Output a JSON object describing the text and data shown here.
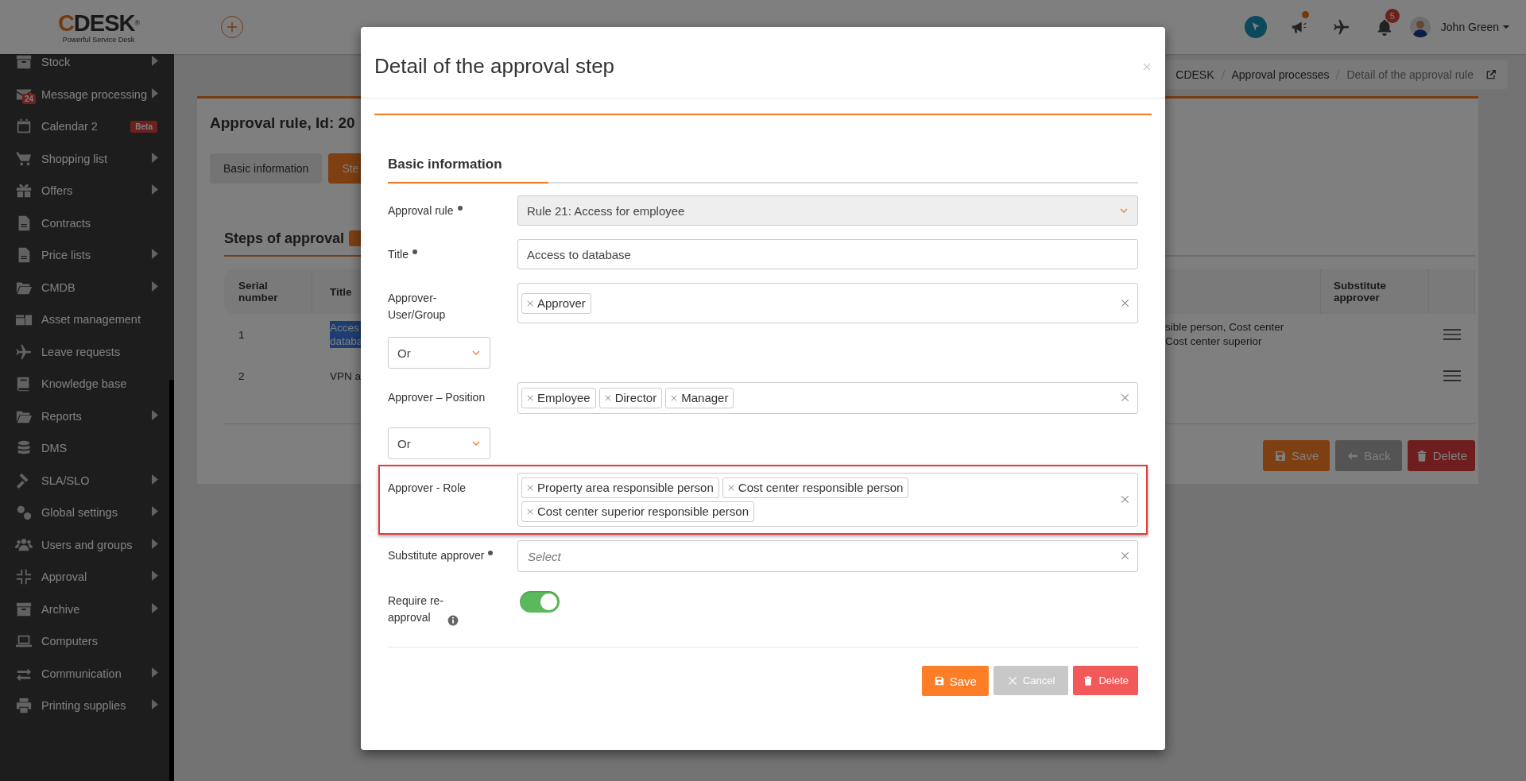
{
  "header": {
    "logo": "CDESK",
    "logo_mark": "®",
    "tagline": "Powerful Service Desk",
    "notifications": "5",
    "user": "John Green"
  },
  "sidebar": {
    "items": [
      {
        "label": "Stock",
        "submenu": true
      },
      {
        "label": "Message processing",
        "submenu": true,
        "badge": "24"
      },
      {
        "label": "Calendar 2",
        "submenu": false,
        "tag": "Beta"
      },
      {
        "label": "Shopping list",
        "submenu": true
      },
      {
        "label": "Offers",
        "submenu": true
      },
      {
        "label": "Contracts",
        "submenu": false
      },
      {
        "label": "Price lists",
        "submenu": true
      },
      {
        "label": "CMDB",
        "submenu": true
      },
      {
        "label": "Asset management",
        "submenu": false
      },
      {
        "label": "Leave requests",
        "submenu": false
      },
      {
        "label": "Knowledge base",
        "submenu": false
      },
      {
        "label": "Reports",
        "submenu": true
      },
      {
        "label": "DMS",
        "submenu": false
      },
      {
        "label": "SLA/SLO",
        "submenu": true
      },
      {
        "label": "Global settings",
        "submenu": true
      },
      {
        "label": "Users and groups",
        "submenu": true
      },
      {
        "label": "Approval",
        "submenu": true
      },
      {
        "label": "Archive",
        "submenu": true
      },
      {
        "label": "Computers",
        "submenu": false
      },
      {
        "label": "Communication",
        "submenu": true
      },
      {
        "label": "Printing supplies",
        "submenu": true
      }
    ]
  },
  "breadcrumb": [
    "CDESK",
    "Approval processes",
    "Detail of the approval rule"
  ],
  "record": {
    "title": "Approval rule, Id: 20",
    "tabs": [
      {
        "label": "Basic information",
        "selected": false
      },
      {
        "label": "Ste",
        "selected": true
      }
    ],
    "section": "Steps of approval",
    "table": {
      "columns": [
        "Serial number",
        "Title",
        "Substitute approver"
      ],
      "rows": [
        {
          "serial": "1",
          "title": "Acces databa",
          "highlighted": true,
          "approvers": "sible person, Cost center Cost center superior"
        },
        {
          "serial": "2",
          "title": "VPN a",
          "highlighted": false
        }
      ]
    },
    "buttons": [
      {
        "kind": "save",
        "label": "Save",
        "disabled": false
      },
      {
        "kind": "back",
        "label": "Back",
        "disabled": true
      },
      {
        "kind": "delete",
        "label": "Delete",
        "disabled": false
      }
    ]
  },
  "modal": {
    "title": "Detail of the approval step",
    "section": "Basic information",
    "fields": [
      {
        "kind": "dropdown",
        "label": "Approval rule",
        "required": true,
        "value": "Rule 21: Access for employee",
        "disabled": true,
        "highlighted": false
      },
      {
        "kind": "text",
        "label": "Title",
        "required": true,
        "value": "Access to database",
        "highlighted": false
      },
      {
        "kind": "tags",
        "label": "Approver-User/Group",
        "required": false,
        "tags": [
          "Approver"
        ],
        "highlighted": false
      },
      {
        "kind": "operator",
        "value": "Or"
      },
      {
        "kind": "tags",
        "label": "Approver – Position",
        "required": false,
        "tags": [
          "Employee",
          "Director",
          "Manager"
        ],
        "highlighted": false
      },
      {
        "kind": "operator",
        "value": "Or"
      },
      {
        "kind": "tags",
        "label": "Approver - Role",
        "required": false,
        "tags": [
          "Property area responsible person",
          "Cost center responsible person",
          "Cost center superior responsible person"
        ],
        "highlighted": true
      },
      {
        "kind": "tags",
        "label": "Substitute approver",
        "required": true,
        "placeholder": "Select",
        "highlighted": false
      },
      {
        "kind": "toggle",
        "label": "Require re-approval",
        "required": false,
        "on": true,
        "info": true,
        "highlighted": false
      }
    ],
    "buttons": [
      {
        "kind": "save",
        "label": "Save"
      },
      {
        "kind": "cancel",
        "label": "Cancel"
      },
      {
        "kind": "delete",
        "label": "Delete"
      }
    ]
  }
}
